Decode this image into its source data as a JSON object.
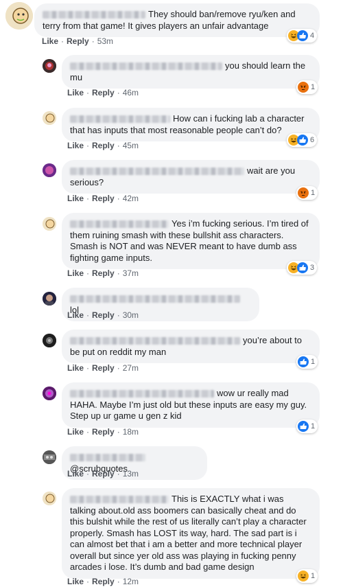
{
  "comments": [
    {
      "text": "They should ban/remove ryu/ken and terry from that game! It gives players an unfair advantage",
      "like": "Like",
      "reply": "Reply",
      "time": "53m",
      "reaction_count": "4",
      "reactions": [
        "haha-icon",
        "like-icon"
      ]
    },
    {
      "text": "you should learn the mu",
      "like": "Like",
      "reply": "Reply",
      "time": "46m",
      "reaction_count": "1",
      "reactions": [
        "angry-icon"
      ]
    },
    {
      "text": "How can i fucking lab a character that has inputs that most reasonable people can’t do?",
      "like": "Like",
      "reply": "Reply",
      "time": "45m",
      "reaction_count": "6",
      "reactions": [
        "haha-icon",
        "like-icon"
      ]
    },
    {
      "text": "wait are you serious?",
      "like": "Like",
      "reply": "Reply",
      "time": "42m",
      "reaction_count": "1",
      "reactions": [
        "angry-icon"
      ]
    },
    {
      "text": "Yes i’m fucking serious. I’m tired of them ruining smash with these bullshit ass characters. Smash is NOT and was NEVER meant to have dumb ass fighting game inputs.",
      "like": "Like",
      "reply": "Reply",
      "time": "37m",
      "reaction_count": "3",
      "reactions": [
        "haha-icon",
        "like-icon"
      ]
    },
    {
      "text": "lol",
      "like": "Like",
      "reply": "Reply",
      "time": "30m",
      "reaction_count": "",
      "reactions": []
    },
    {
      "text": "you’re about to be put on reddit my man",
      "like": "Like",
      "reply": "Reply",
      "time": "27m",
      "reaction_count": "1",
      "reactions": [
        "like-icon"
      ]
    },
    {
      "text": "wow ur really mad HAHA. Maybe I’m just old but these inputs are easy my guy. Step up ur game u gen z kid",
      "like": "Like",
      "reply": "Reply",
      "time": "18m",
      "reaction_count": "1",
      "reactions": [
        "like-icon"
      ]
    },
    {
      "text": "@scrubquotes",
      "like": "Like",
      "reply": "Reply",
      "time": "13m",
      "reaction_count": "",
      "reactions": []
    },
    {
      "text": "This is EXACTLY what i was talking about.old ass boomers can basically cheat and do this bulshit while the rest of us literally can’t play a character properly. Smash has LOST its way, hard. The sad part is i can almost bet that i am a better and more technical player overall but since yer old ass was playing in fucking penny arcades i lose. It’s dumb and bad game design",
      "like": "Like",
      "reply": "Reply",
      "time": "12m",
      "reaction_count": "1",
      "reactions": [
        "haha-icon"
      ]
    }
  ],
  "separator": "·",
  "colors": {
    "link": "#4b4f56",
    "bubble": "#f2f3f5",
    "like": "#1877f2",
    "haha": "#f7b125",
    "angry": "#e9710f"
  }
}
